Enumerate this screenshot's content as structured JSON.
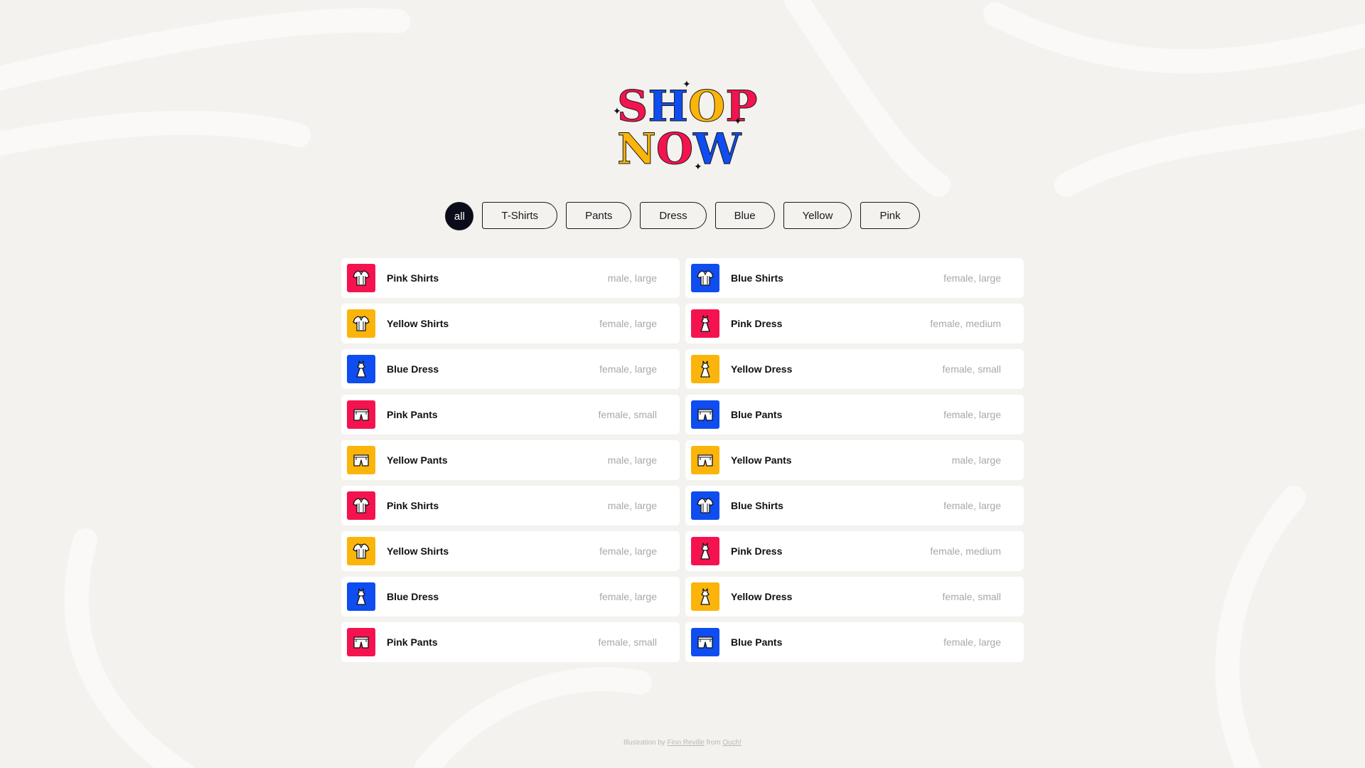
{
  "logo": {
    "line1": [
      "S",
      "H",
      "O",
      "P"
    ],
    "line2": [
      "N",
      "O",
      "W"
    ],
    "colors": {
      "pink": "#f5134f",
      "blue": "#0f4df0",
      "yellow": "#fbb40a"
    }
  },
  "filters": [
    "all",
    "T-Shirts",
    "Pants",
    "Dress",
    "Blue",
    "Yellow",
    "Pink"
  ],
  "items": [
    {
      "name": "Pink Shirts",
      "meta": "male, large",
      "color": "#f5134f",
      "icon": "shirt-icon"
    },
    {
      "name": "Blue Shirts",
      "meta": "female, large",
      "color": "#0f4df0",
      "icon": "shirt-icon"
    },
    {
      "name": "Yellow Shirts",
      "meta": "female, large",
      "color": "#fbb40a",
      "icon": "shirt-icon"
    },
    {
      "name": "Pink Dress",
      "meta": "female, medium",
      "color": "#f5134f",
      "icon": "dress-icon"
    },
    {
      "name": "Blue Dress",
      "meta": "female, large",
      "color": "#0f4df0",
      "icon": "dress-icon"
    },
    {
      "name": "Yellow Dress",
      "meta": "female, small",
      "color": "#fbb40a",
      "icon": "dress-icon"
    },
    {
      "name": "Pink Pants",
      "meta": "female, small",
      "color": "#f5134f",
      "icon": "pants-icon"
    },
    {
      "name": "Blue Pants",
      "meta": "female, large",
      "color": "#0f4df0",
      "icon": "pants-icon"
    },
    {
      "name": "Yellow Pants",
      "meta": "male, large",
      "color": "#fbb40a",
      "icon": "pants-icon"
    },
    {
      "name": "Yellow Pants",
      "meta": "male, large",
      "color": "#fbb40a",
      "icon": "pants-icon"
    },
    {
      "name": "Pink Shirts",
      "meta": "male, large",
      "color": "#f5134f",
      "icon": "shirt-icon"
    },
    {
      "name": "Blue Shirts",
      "meta": "female, large",
      "color": "#0f4df0",
      "icon": "shirt-icon"
    },
    {
      "name": "Yellow Shirts",
      "meta": "female, large",
      "color": "#fbb40a",
      "icon": "shirt-icon"
    },
    {
      "name": "Pink Dress",
      "meta": "female, medium",
      "color": "#f5134f",
      "icon": "dress-icon"
    },
    {
      "name": "Blue Dress",
      "meta": "female, large",
      "color": "#0f4df0",
      "icon": "dress-icon"
    },
    {
      "name": "Yellow Dress",
      "meta": "female, small",
      "color": "#fbb40a",
      "icon": "dress-icon"
    },
    {
      "name": "Pink Pants",
      "meta": "female, small",
      "color": "#f5134f",
      "icon": "pants-icon"
    },
    {
      "name": "Blue Pants",
      "meta": "female, large",
      "color": "#0f4df0",
      "icon": "pants-icon"
    }
  ],
  "credit": {
    "prefix": "Illustration by",
    "author": "Finn Reville",
    "middle": "from",
    "source": "Ouch!"
  }
}
